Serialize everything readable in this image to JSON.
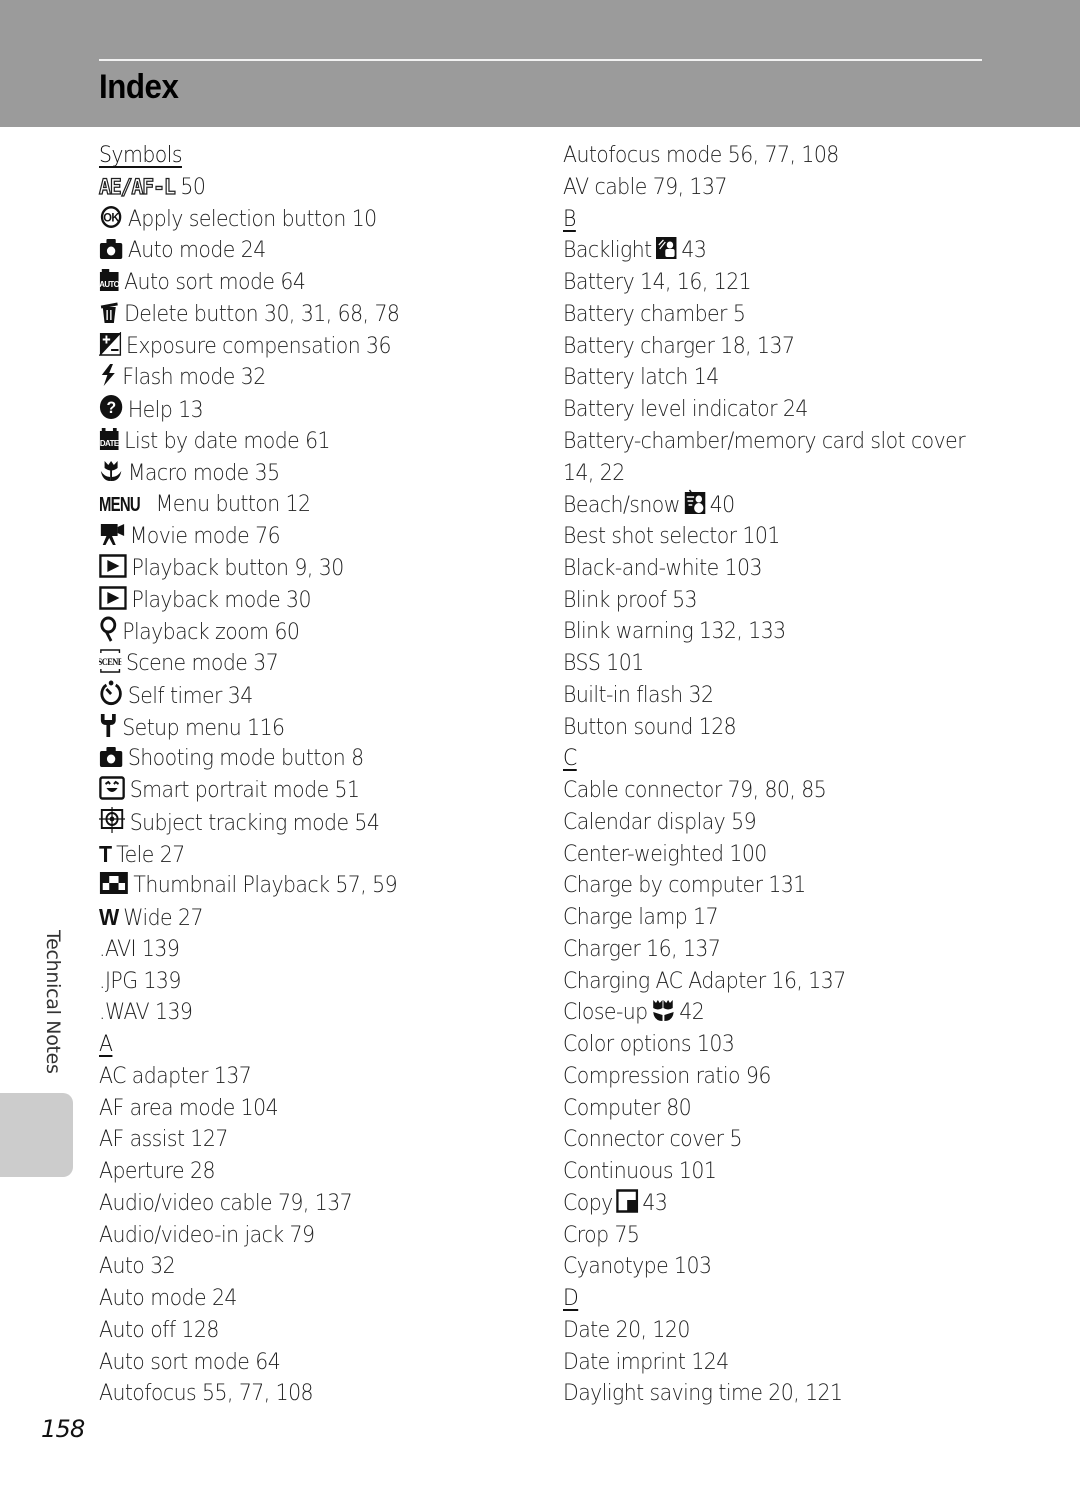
{
  "header": {
    "title": "Index"
  },
  "side_tab": {
    "label": "Technical Notes"
  },
  "page_number": "158",
  "left_column": [
    {
      "type": "heading",
      "text": "Symbols"
    },
    {
      "type": "entry",
      "icon": "ae-af-lock-icon",
      "icon_text": "AE/AF-L",
      "text": "50"
    },
    {
      "type": "entry",
      "icon": "ok-button-icon",
      "text": "Apply selection button 10"
    },
    {
      "type": "entry",
      "icon": "camera-icon",
      "text": "Auto mode 24"
    },
    {
      "type": "entry",
      "icon": "auto-sort-icon",
      "text": "Auto sort mode 64"
    },
    {
      "type": "entry",
      "icon": "trash-icon",
      "text": "Delete button 30, 31, 68, 78"
    },
    {
      "type": "entry",
      "icon": "exposure-compensation-icon",
      "text": "Exposure compensation 36"
    },
    {
      "type": "entry",
      "icon": "flash-icon",
      "text": "Flash mode 32"
    },
    {
      "type": "entry",
      "icon": "help-icon",
      "text": "Help 13"
    },
    {
      "type": "entry",
      "icon": "list-by-date-icon",
      "text": "List by date mode 61"
    },
    {
      "type": "entry",
      "icon": "macro-icon",
      "text": "Macro mode 35"
    },
    {
      "type": "entry",
      "icon": "menu-icon",
      "icon_text": "MENU",
      "text": "Menu button 12"
    },
    {
      "type": "entry",
      "icon": "movie-camera-icon",
      "text": "Movie mode 76"
    },
    {
      "type": "entry",
      "icon": "playback-icon",
      "text": "Playback button 9, 30"
    },
    {
      "type": "entry",
      "icon": "playback-icon",
      "text": "Playback mode 30"
    },
    {
      "type": "entry",
      "icon": "zoom-magnifier-icon",
      "text": "Playback zoom 60"
    },
    {
      "type": "entry",
      "icon": "scene-icon",
      "text": "Scene mode 37"
    },
    {
      "type": "entry",
      "icon": "self-timer-icon",
      "text": "Self timer 34"
    },
    {
      "type": "entry",
      "icon": "wrench-icon",
      "text": "Setup menu 116"
    },
    {
      "type": "entry",
      "icon": "camera-icon",
      "text": "Shooting mode button 8"
    },
    {
      "type": "entry",
      "icon": "smart-portrait-icon",
      "text": "Smart portrait mode 51"
    },
    {
      "type": "entry",
      "icon": "subject-tracking-icon",
      "text": "Subject tracking mode 54"
    },
    {
      "type": "entry",
      "icon": "tele-icon",
      "icon_text": "T",
      "text": "Tele 27"
    },
    {
      "type": "entry",
      "icon": "thumbnail-icon",
      "text": "Thumbnail Playback 57, 59"
    },
    {
      "type": "entry",
      "icon": "wide-icon",
      "icon_text": "W",
      "text": "Wide 27"
    },
    {
      "type": "entry",
      "text": ".AVI 139"
    },
    {
      "type": "entry",
      "text": ".JPG 139"
    },
    {
      "type": "entry",
      "text": ".WAV 139"
    },
    {
      "type": "heading",
      "text": "A"
    },
    {
      "type": "entry",
      "text": "AC adapter 137"
    },
    {
      "type": "entry",
      "text": "AF area mode 104"
    },
    {
      "type": "entry",
      "text": "AF assist 127"
    },
    {
      "type": "entry",
      "text": "Aperture 28"
    },
    {
      "type": "entry",
      "text": "Audio/video cable 79, 137"
    },
    {
      "type": "entry",
      "text": "Audio/video-in jack 79"
    },
    {
      "type": "entry",
      "text": "Auto 32"
    },
    {
      "type": "entry",
      "text": "Auto mode 24"
    },
    {
      "type": "entry",
      "text": "Auto off 128"
    },
    {
      "type": "entry",
      "text": "Auto sort mode 64"
    },
    {
      "type": "entry",
      "text": "Autofocus 55, 77, 108"
    }
  ],
  "right_column": [
    {
      "type": "entry",
      "text": "Autofocus mode 56, 77, 108"
    },
    {
      "type": "entry",
      "text": "AV cable 79, 137"
    },
    {
      "type": "heading",
      "text": "B"
    },
    {
      "type": "entry",
      "text": "Backlight",
      "inline_icon": "backlight-icon",
      "text_after": "43"
    },
    {
      "type": "entry",
      "text": "Battery 14, 16, 121"
    },
    {
      "type": "entry",
      "text": "Battery chamber 5"
    },
    {
      "type": "entry",
      "text": "Battery charger 18, 137"
    },
    {
      "type": "entry",
      "text": "Battery latch 14"
    },
    {
      "type": "entry",
      "text": "Battery level indicator 24"
    },
    {
      "type": "entry",
      "text": "Battery-chamber/memory card slot cover"
    },
    {
      "type": "entry",
      "text": "14, 22"
    },
    {
      "type": "entry",
      "text": "Beach/snow",
      "inline_icon": "beach-snow-icon",
      "text_after": "40"
    },
    {
      "type": "entry",
      "text": "Best shot selector 101"
    },
    {
      "type": "entry",
      "text": "Black-and-white 103"
    },
    {
      "type": "entry",
      "text": "Blink proof 53"
    },
    {
      "type": "entry",
      "text": "Blink warning 132, 133"
    },
    {
      "type": "entry",
      "text": "BSS 101"
    },
    {
      "type": "entry",
      "text": "Built-in flash 32"
    },
    {
      "type": "entry",
      "text": "Button sound 128"
    },
    {
      "type": "heading",
      "text": "C"
    },
    {
      "type": "entry",
      "text": "Cable connector 79, 80, 85"
    },
    {
      "type": "entry",
      "text": "Calendar display 59"
    },
    {
      "type": "entry",
      "text": "Center-weighted 100"
    },
    {
      "type": "entry",
      "text": "Charge by computer 131"
    },
    {
      "type": "entry",
      "text": "Charge lamp 17"
    },
    {
      "type": "entry",
      "text": "Charger 16, 137"
    },
    {
      "type": "entry",
      "text": "Charging AC Adapter 16, 137"
    },
    {
      "type": "entry",
      "text": "Close-up",
      "inline_icon": "close-up-icon",
      "text_after": "42"
    },
    {
      "type": "entry",
      "text": "Color options 103"
    },
    {
      "type": "entry",
      "text": "Compression ratio 96"
    },
    {
      "type": "entry",
      "text": "Computer 80"
    },
    {
      "type": "entry",
      "text": "Connector cover 5"
    },
    {
      "type": "entry",
      "text": "Continuous 101"
    },
    {
      "type": "entry",
      "text": "Copy",
      "inline_icon": "copy-icon",
      "text_after": "43"
    },
    {
      "type": "entry",
      "text": "Crop 75"
    },
    {
      "type": "entry",
      "text": "Cyanotype 103"
    },
    {
      "type": "heading",
      "text": "D"
    },
    {
      "type": "entry",
      "text": "Date 20, 120"
    },
    {
      "type": "entry",
      "text": "Date imprint 124"
    },
    {
      "type": "entry",
      "text": "Daylight saving time 20, 121"
    }
  ]
}
